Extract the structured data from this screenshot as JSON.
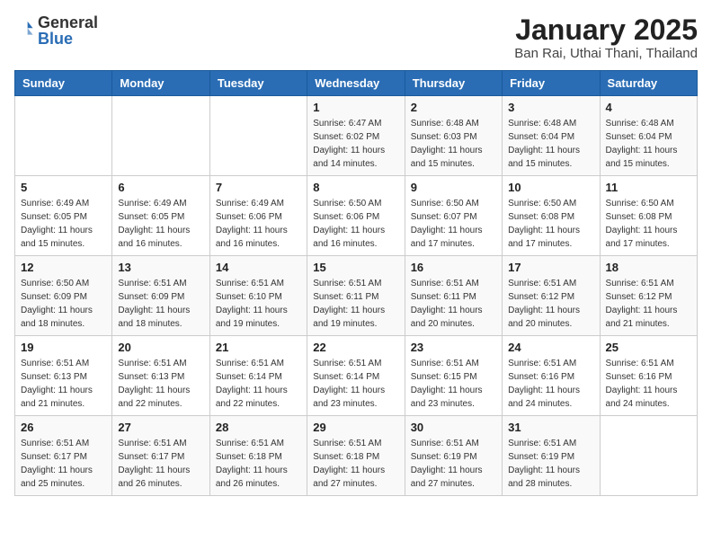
{
  "logo": {
    "general": "General",
    "blue": "Blue"
  },
  "title": "January 2025",
  "subtitle": "Ban Rai, Uthai Thani, Thailand",
  "days_of_week": [
    "Sunday",
    "Monday",
    "Tuesday",
    "Wednesday",
    "Thursday",
    "Friday",
    "Saturday"
  ],
  "weeks": [
    [
      {
        "day": "",
        "sunrise": "",
        "sunset": "",
        "daylight": ""
      },
      {
        "day": "",
        "sunrise": "",
        "sunset": "",
        "daylight": ""
      },
      {
        "day": "",
        "sunrise": "",
        "sunset": "",
        "daylight": ""
      },
      {
        "day": "1",
        "sunrise": "Sunrise: 6:47 AM",
        "sunset": "Sunset: 6:02 PM",
        "daylight": "Daylight: 11 hours and 14 minutes."
      },
      {
        "day": "2",
        "sunrise": "Sunrise: 6:48 AM",
        "sunset": "Sunset: 6:03 PM",
        "daylight": "Daylight: 11 hours and 15 minutes."
      },
      {
        "day": "3",
        "sunrise": "Sunrise: 6:48 AM",
        "sunset": "Sunset: 6:04 PM",
        "daylight": "Daylight: 11 hours and 15 minutes."
      },
      {
        "day": "4",
        "sunrise": "Sunrise: 6:48 AM",
        "sunset": "Sunset: 6:04 PM",
        "daylight": "Daylight: 11 hours and 15 minutes."
      }
    ],
    [
      {
        "day": "5",
        "sunrise": "Sunrise: 6:49 AM",
        "sunset": "Sunset: 6:05 PM",
        "daylight": "Daylight: 11 hours and 15 minutes."
      },
      {
        "day": "6",
        "sunrise": "Sunrise: 6:49 AM",
        "sunset": "Sunset: 6:05 PM",
        "daylight": "Daylight: 11 hours and 16 minutes."
      },
      {
        "day": "7",
        "sunrise": "Sunrise: 6:49 AM",
        "sunset": "Sunset: 6:06 PM",
        "daylight": "Daylight: 11 hours and 16 minutes."
      },
      {
        "day": "8",
        "sunrise": "Sunrise: 6:50 AM",
        "sunset": "Sunset: 6:06 PM",
        "daylight": "Daylight: 11 hours and 16 minutes."
      },
      {
        "day": "9",
        "sunrise": "Sunrise: 6:50 AM",
        "sunset": "Sunset: 6:07 PM",
        "daylight": "Daylight: 11 hours and 17 minutes."
      },
      {
        "day": "10",
        "sunrise": "Sunrise: 6:50 AM",
        "sunset": "Sunset: 6:08 PM",
        "daylight": "Daylight: 11 hours and 17 minutes."
      },
      {
        "day": "11",
        "sunrise": "Sunrise: 6:50 AM",
        "sunset": "Sunset: 6:08 PM",
        "daylight": "Daylight: 11 hours and 17 minutes."
      }
    ],
    [
      {
        "day": "12",
        "sunrise": "Sunrise: 6:50 AM",
        "sunset": "Sunset: 6:09 PM",
        "daylight": "Daylight: 11 hours and 18 minutes."
      },
      {
        "day": "13",
        "sunrise": "Sunrise: 6:51 AM",
        "sunset": "Sunset: 6:09 PM",
        "daylight": "Daylight: 11 hours and 18 minutes."
      },
      {
        "day": "14",
        "sunrise": "Sunrise: 6:51 AM",
        "sunset": "Sunset: 6:10 PM",
        "daylight": "Daylight: 11 hours and 19 minutes."
      },
      {
        "day": "15",
        "sunrise": "Sunrise: 6:51 AM",
        "sunset": "Sunset: 6:11 PM",
        "daylight": "Daylight: 11 hours and 19 minutes."
      },
      {
        "day": "16",
        "sunrise": "Sunrise: 6:51 AM",
        "sunset": "Sunset: 6:11 PM",
        "daylight": "Daylight: 11 hours and 20 minutes."
      },
      {
        "day": "17",
        "sunrise": "Sunrise: 6:51 AM",
        "sunset": "Sunset: 6:12 PM",
        "daylight": "Daylight: 11 hours and 20 minutes."
      },
      {
        "day": "18",
        "sunrise": "Sunrise: 6:51 AM",
        "sunset": "Sunset: 6:12 PM",
        "daylight": "Daylight: 11 hours and 21 minutes."
      }
    ],
    [
      {
        "day": "19",
        "sunrise": "Sunrise: 6:51 AM",
        "sunset": "Sunset: 6:13 PM",
        "daylight": "Daylight: 11 hours and 21 minutes."
      },
      {
        "day": "20",
        "sunrise": "Sunrise: 6:51 AM",
        "sunset": "Sunset: 6:13 PM",
        "daylight": "Daylight: 11 hours and 22 minutes."
      },
      {
        "day": "21",
        "sunrise": "Sunrise: 6:51 AM",
        "sunset": "Sunset: 6:14 PM",
        "daylight": "Daylight: 11 hours and 22 minutes."
      },
      {
        "day": "22",
        "sunrise": "Sunrise: 6:51 AM",
        "sunset": "Sunset: 6:14 PM",
        "daylight": "Daylight: 11 hours and 23 minutes."
      },
      {
        "day": "23",
        "sunrise": "Sunrise: 6:51 AM",
        "sunset": "Sunset: 6:15 PM",
        "daylight": "Daylight: 11 hours and 23 minutes."
      },
      {
        "day": "24",
        "sunrise": "Sunrise: 6:51 AM",
        "sunset": "Sunset: 6:16 PM",
        "daylight": "Daylight: 11 hours and 24 minutes."
      },
      {
        "day": "25",
        "sunrise": "Sunrise: 6:51 AM",
        "sunset": "Sunset: 6:16 PM",
        "daylight": "Daylight: 11 hours and 24 minutes."
      }
    ],
    [
      {
        "day": "26",
        "sunrise": "Sunrise: 6:51 AM",
        "sunset": "Sunset: 6:17 PM",
        "daylight": "Daylight: 11 hours and 25 minutes."
      },
      {
        "day": "27",
        "sunrise": "Sunrise: 6:51 AM",
        "sunset": "Sunset: 6:17 PM",
        "daylight": "Daylight: 11 hours and 26 minutes."
      },
      {
        "day": "28",
        "sunrise": "Sunrise: 6:51 AM",
        "sunset": "Sunset: 6:18 PM",
        "daylight": "Daylight: 11 hours and 26 minutes."
      },
      {
        "day": "29",
        "sunrise": "Sunrise: 6:51 AM",
        "sunset": "Sunset: 6:18 PM",
        "daylight": "Daylight: 11 hours and 27 minutes."
      },
      {
        "day": "30",
        "sunrise": "Sunrise: 6:51 AM",
        "sunset": "Sunset: 6:19 PM",
        "daylight": "Daylight: 11 hours and 27 minutes."
      },
      {
        "day": "31",
        "sunrise": "Sunrise: 6:51 AM",
        "sunset": "Sunset: 6:19 PM",
        "daylight": "Daylight: 11 hours and 28 minutes."
      },
      {
        "day": "",
        "sunrise": "",
        "sunset": "",
        "daylight": ""
      }
    ]
  ]
}
